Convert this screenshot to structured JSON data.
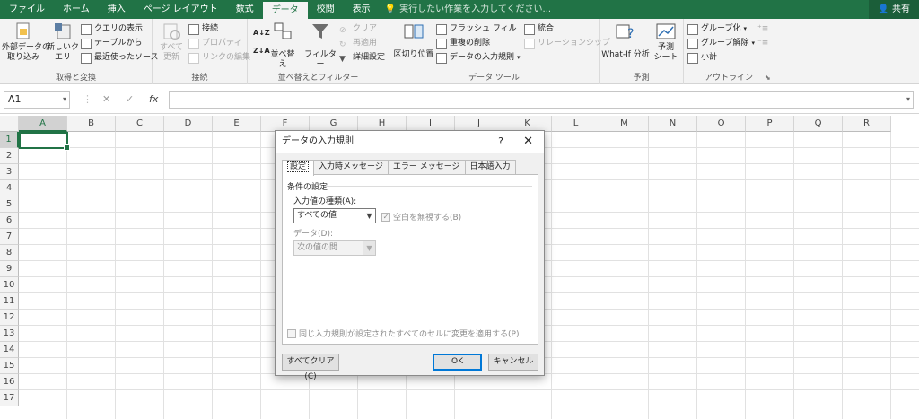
{
  "tabs": [
    "ファイル",
    "ホーム",
    "挿入",
    "ページ レイアウト",
    "数式",
    "データ",
    "校閲",
    "表示"
  ],
  "active_tab": "データ",
  "tell_me": "実行したい作業を入力してください...",
  "share": "共有",
  "ribbon": {
    "get_transform": {
      "external_data": "外部データの\n取り込み",
      "new_query": "新しいク\nエリ",
      "show_queries": "クエリの表示",
      "from_table": "テーブルから",
      "recent_sources": "最近使ったソース",
      "label": "取得と変換"
    },
    "connections": {
      "refresh_all": "すべて\n更新",
      "connections": "接続",
      "properties": "プロパティ",
      "edit_links": "リンクの編集",
      "label": "接続"
    },
    "sort_filter": {
      "sort": "並べ替え",
      "filter": "フィルター",
      "clear": "クリア",
      "reapply": "再適用",
      "advanced": "詳細設定",
      "label": "並べ替えとフィルター"
    },
    "data_tools": {
      "text_to_columns": "区切り位置",
      "flash_fill": "フラッシュ フィル",
      "remove_duplicates": "重複の削除",
      "data_validation": "データの入力規則",
      "consolidate": "統合",
      "relationships": "リレーションシップ",
      "label": "データ ツール"
    },
    "forecast": {
      "what_if": "What-If 分析",
      "forecast_sheet": "予測\nシート",
      "label": "予測"
    },
    "outline": {
      "group": "グループ化",
      "ungroup": "グループ解除",
      "subtotal": "小計",
      "label": "アウトライン"
    }
  },
  "formula_bar": {
    "name_box": "A1",
    "cancel": "✕",
    "enter": "✓",
    "fx": "fx",
    "value": ""
  },
  "columns": [
    "A",
    "B",
    "C",
    "D",
    "E",
    "F",
    "G",
    "H",
    "I",
    "J",
    "K",
    "L",
    "M",
    "N",
    "O",
    "P",
    "Q",
    "R"
  ],
  "rows": [
    "1",
    "2",
    "3",
    "4",
    "5",
    "6",
    "7",
    "8",
    "9",
    "10",
    "11",
    "12",
    "13",
    "14",
    "15",
    "16",
    "17"
  ],
  "dialog": {
    "title": "データの入力規則",
    "help": "?",
    "close": "✕",
    "tabs": [
      "設定",
      "入力時メッセージ",
      "エラー メッセージ",
      "日本語入力"
    ],
    "section": "条件の設定",
    "allow_label": "入力値の種類(A):",
    "allow_value": "すべての値",
    "ignore_blank": "空白を無視する(B)",
    "data_label": "データ(D):",
    "data_value": "次の値の間",
    "apply_all": "同じ入力規則が設定されたすべてのセルに変更を適用する(P)",
    "clear_all": "すべてクリア(C)",
    "ok": "OK",
    "cancel": "キャンセル"
  },
  "colors": {
    "accent": "#217346",
    "ok_border": "#0078d7"
  }
}
